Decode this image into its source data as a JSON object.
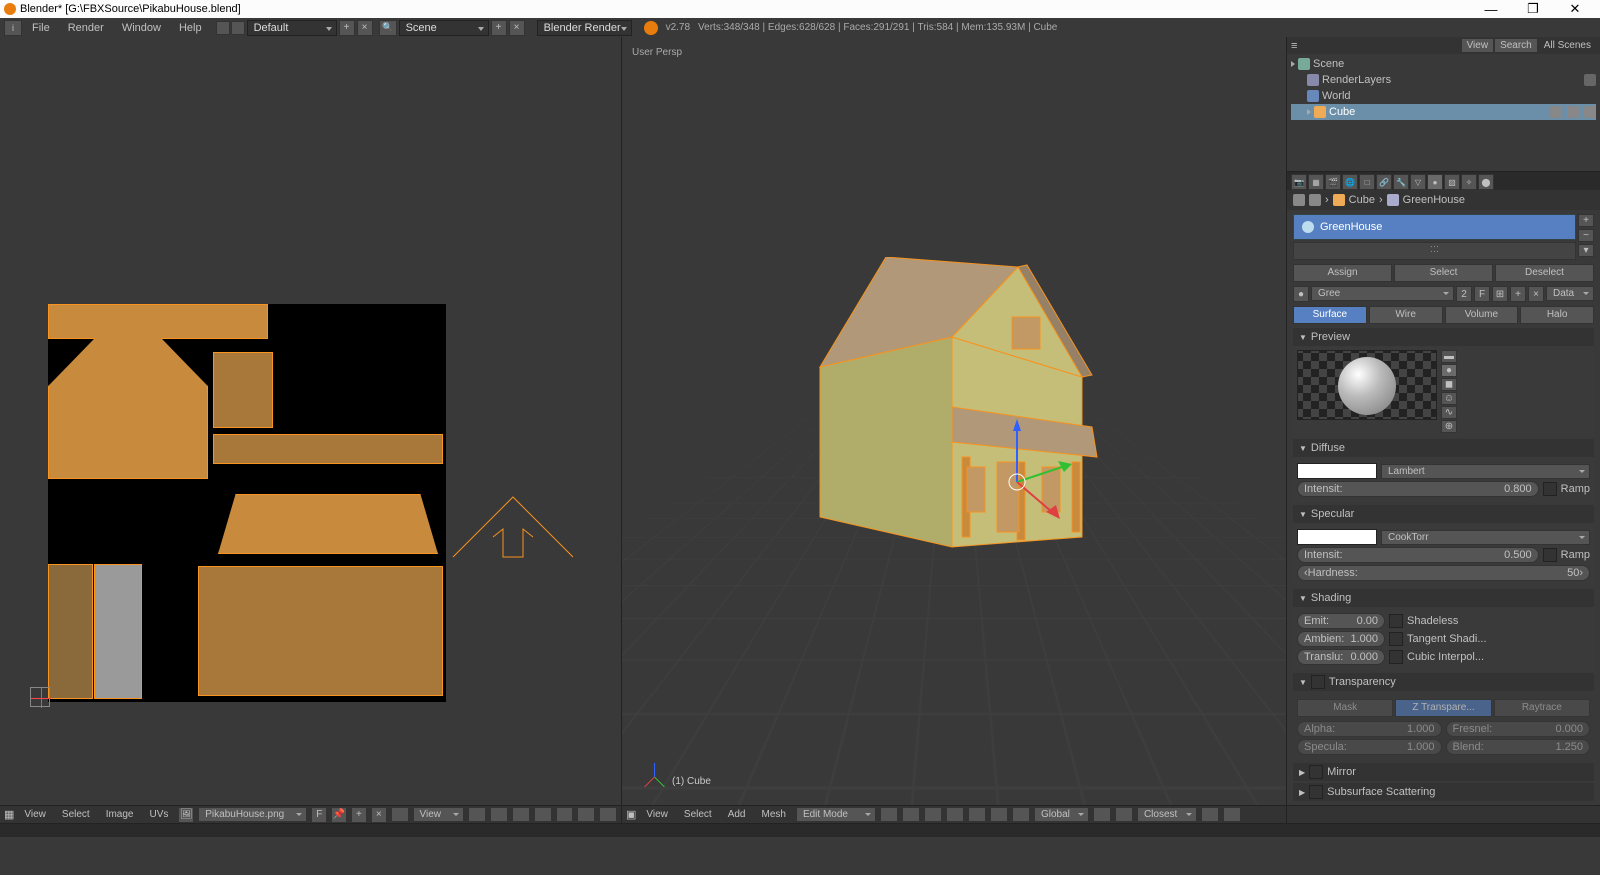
{
  "titlebar": {
    "title": "Blender* [G:\\FBXSource\\PikabuHouse.blend]",
    "minimize": "—",
    "maximize": "❐",
    "close": "✕"
  },
  "topbar": {
    "menus": [
      "File",
      "Render",
      "Window",
      "Help"
    ],
    "layout": "Default",
    "scene": "Scene",
    "renderer": "Blender Render",
    "version": "v2.78",
    "stats": "Verts:348/348 | Edges:628/628 | Faces:291/291 | Tris:584 | Mem:135.93M | Cube"
  },
  "uv_footer": {
    "menus": [
      "View",
      "Select",
      "Image",
      "UVs"
    ],
    "image": "PikabuHouse.png",
    "f_btn": "F"
  },
  "view3d": {
    "persp_label": "User Persp",
    "object_label": "(1) Cube"
  },
  "v3d_footer": {
    "menus": [
      "View",
      "Select",
      "Add",
      "Mesh"
    ],
    "mode": "Edit Mode",
    "orientation": "Global",
    "snap": "Closest"
  },
  "outliner": {
    "tabs": [
      "View",
      "Search",
      "All Scenes"
    ],
    "scene": "Scene",
    "renderlayers": "RenderLayers",
    "world": "World",
    "cube": "Cube"
  },
  "breadcrumb": {
    "obj": "Cube",
    "sep": "›",
    "mat": "GreenHouse"
  },
  "material": {
    "name": "GreenHouse",
    "assign": "Assign",
    "select": "Select",
    "deselect": "Deselect",
    "mat_dd": "Gree",
    "two": "2",
    "f": "F",
    "data": "Data",
    "render_tabs": [
      "Surface",
      "Wire",
      "Volume",
      "Halo"
    ]
  },
  "panels": {
    "preview": "Preview",
    "diffuse": "Diffuse",
    "specular": "Specular",
    "shading": "Shading",
    "transparency": "Transparency",
    "mirror": "Mirror",
    "sss": "Subsurface Scattering"
  },
  "diffuse": {
    "type": "Lambert",
    "intensity_lbl": "Intensit:",
    "intensity_val": "0.800",
    "ramp": "Ramp"
  },
  "specular": {
    "type": "CookTorr",
    "intensity_lbl": "Intensit:",
    "intensity_val": "0.500",
    "ramp": "Ramp",
    "hardness_lbl": "Hardness:",
    "hardness_val": "50"
  },
  "shading": {
    "emit_lbl": "Emit:",
    "emit_val": "0.00",
    "ambient_lbl": "Ambien:",
    "ambient_val": "1.000",
    "translu_lbl": "Translu:",
    "translu_val": "0.000",
    "shadeless": "Shadeless",
    "tangent": "Tangent Shadi...",
    "cubic": "Cubic Interpol..."
  },
  "transparency": {
    "mask": "Mask",
    "ztrans": "Z Transpare...",
    "raytrace": "Raytrace",
    "alpha_lbl": "Alpha:",
    "alpha_val": "1.000",
    "fresnel_lbl": "Fresnel:",
    "fresnel_val": "0.000",
    "specular_lbl": "Specula:",
    "specular_val": "1.000",
    "blend_lbl": "Blend:",
    "blend_val": "1.250"
  }
}
